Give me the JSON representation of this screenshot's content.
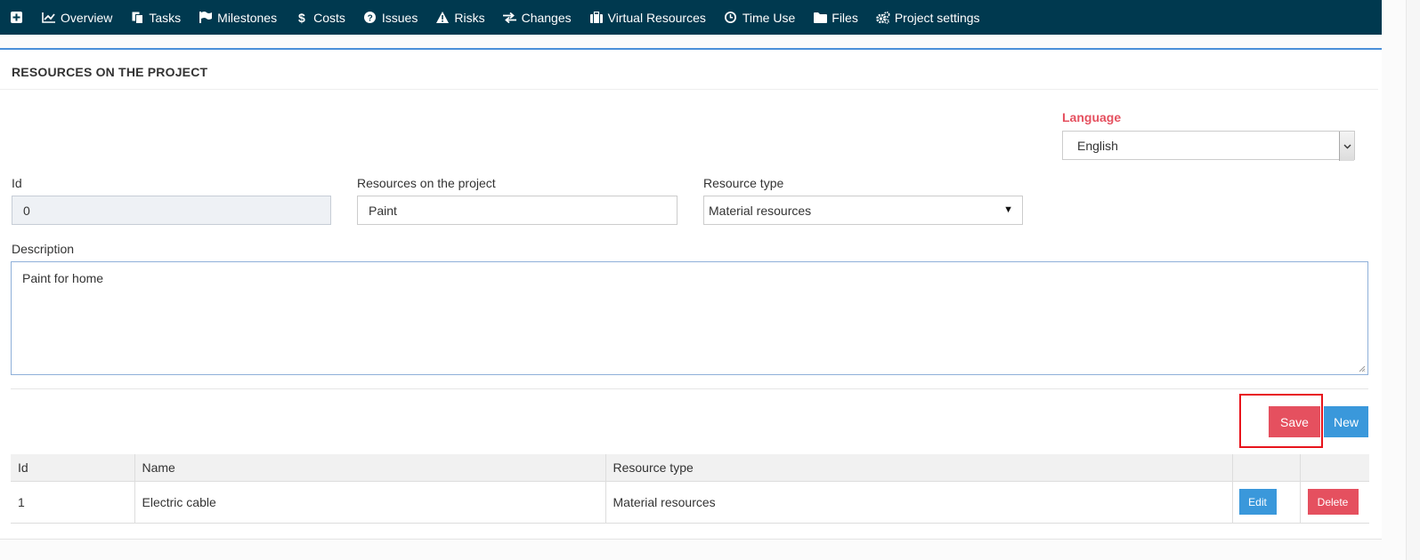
{
  "nav": {
    "add_icon": "plus-square-icon",
    "items": [
      {
        "label": "Overview",
        "icon": "line-chart-icon"
      },
      {
        "label": "Tasks",
        "icon": "copy-icon"
      },
      {
        "label": "Milestones",
        "icon": "flag-icon"
      },
      {
        "label": "Costs",
        "icon": "dollar-icon"
      },
      {
        "label": "Issues",
        "icon": "question-circle-icon"
      },
      {
        "label": "Risks",
        "icon": "warning-icon"
      },
      {
        "label": "Changes",
        "icon": "exchange-icon"
      },
      {
        "label": "Virtual Resources",
        "icon": "briefcase-icon"
      },
      {
        "label": "Time Use",
        "icon": "clock-icon"
      },
      {
        "label": "Files",
        "icon": "folder-icon"
      },
      {
        "label": "Project settings",
        "icon": "gears-icon"
      }
    ]
  },
  "panel": {
    "title": "RESOURCES ON THE PROJECT"
  },
  "form": {
    "language_label": "Language",
    "language_value": "English",
    "id_label": "Id",
    "id_value": "0",
    "name_label": "Resources on the project",
    "name_value": "Paint",
    "type_label": "Resource type",
    "type_value": "Material resources",
    "description_label": "Description",
    "description_value": "Paint for home"
  },
  "actions": {
    "save": "Save",
    "new": "New"
  },
  "table": {
    "headers": [
      "Id",
      "Name",
      "Resource type",
      "",
      ""
    ],
    "rows": [
      {
        "id": "1",
        "name": "Electric cable",
        "type": "Material resources",
        "edit": "Edit",
        "delete": "Delete"
      }
    ]
  },
  "colors": {
    "navbar": "#00394f",
    "accent_blue": "#3a98db",
    "danger_red": "#e5505f",
    "highlight": "#e8141c"
  }
}
